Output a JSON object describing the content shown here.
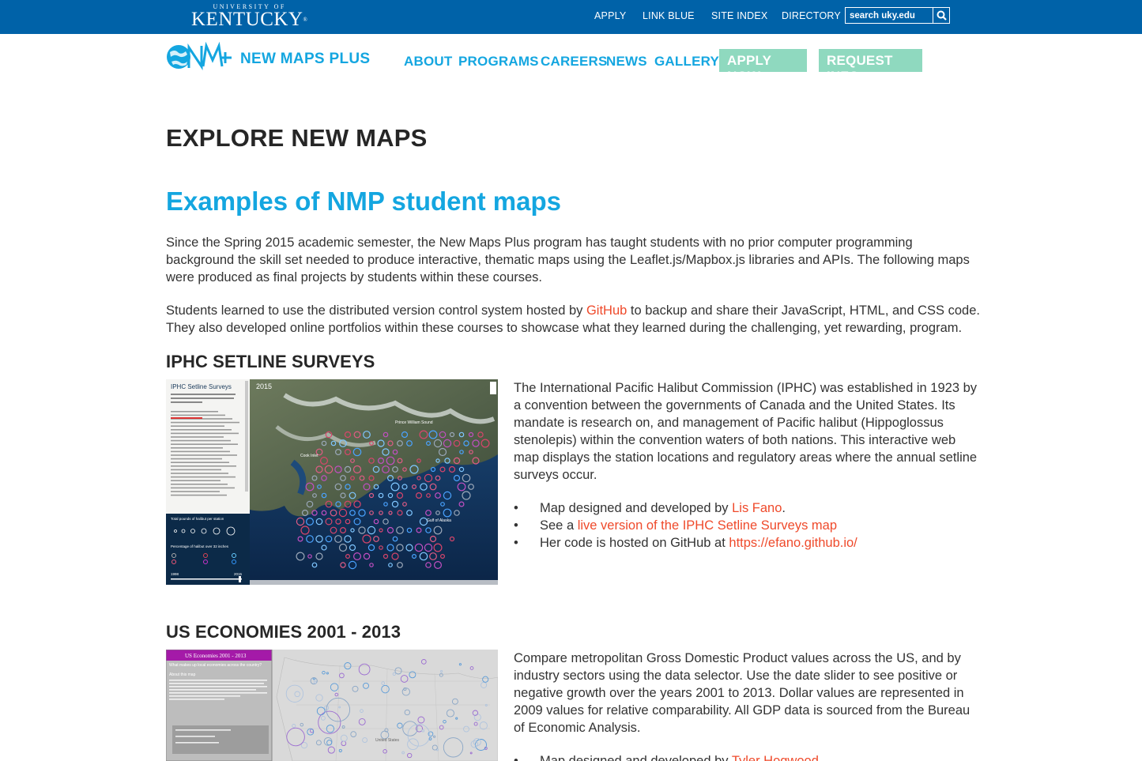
{
  "uk_bar": {
    "logo_top": "UNIVERSITY OF",
    "logo_main": "KENTUCKY",
    "links": [
      "APPLY",
      "LINK BLUE",
      "SITE INDEX",
      "DIRECTORY"
    ],
    "search_value": "search uky.edu"
  },
  "site": {
    "title": "NEW MAPS PLUS"
  },
  "nav": {
    "items": [
      "ABOUT",
      "PROGRAMS",
      "CAREERS",
      "NEWS",
      "GALLERY"
    ],
    "apply_now": "APPLY NOW",
    "request_info": "REQUEST INFO"
  },
  "page": {
    "heading": "EXPLORE NEW MAPS",
    "subheading": "Examples of NMP student maps",
    "intro": "Since the Spring 2015 academic semester, the New Maps Plus program has taught students with no prior computer programming background the skill set needed to produce interactive, thematic maps using the Leaflet.js/Mapbox.js libraries and APIs. The following maps were produced as final projects by students within these courses.",
    "para2_before": "Students learned to use the distributed version control system hosted by ",
    "para2_link": "GitHub",
    "para2_after": " to backup and share their JavaScript, HTML, and CSS code. They also developed online portfolios within these courses to showcase what they learned during the challenging, yet rewarding, program."
  },
  "sections": [
    {
      "title": "IPHC SETLINE SURVEYS",
      "description": "The International Pacific Halibut Commission (IPHC) was established in 1923 by a convention between the governments of Canada and the United States. Its mandate is research on, and management of Pacific halibut (Hippoglossus stenolepis) within the convention waters of both nations. This interactive web map displays the station locations and regulatory areas where the annual setline surveys occur.",
      "bullet1_before": "Map designed and developed by ",
      "bullet1_link": "Lis Fano",
      "bullet1_after": ".",
      "bullet2_before": "See a ",
      "bullet2_link": "live version of the IPHC Setline Surveys map",
      "bullet3_before": "Her code is hosted on GitHub at ",
      "bullet3_link": "https://efano.github.io/",
      "thumb": {
        "title": "IPHC Setline Surveys",
        "subtitle": "Mapping change in weight, length, and abundance of Pacific Halibut: 1998 - 2015",
        "year": "2015",
        "legend_title": "Total pounds of halibut per station",
        "legend_pct": "Percentage of halibut over 32 inches",
        "slider_start": "1998",
        "slider_end": "2015",
        "place1": "Cook Inlet",
        "place2": "Prince William Sound",
        "place3": "Gulf of Alaska"
      }
    },
    {
      "title": "US ECONOMIES 2001 - 2013",
      "description": "Compare metropolitan Gross Domestic Product values across the US, and by industry sectors using the data selector. Use the date slider to see positive or negative growth over the years 2001 to 2013. Dollar values are represented in 2009 values for relative comparability. All GDP data is sourced from the Bureau of Economic Analysis.",
      "bullet1_before": "Map designed and developed by ",
      "bullet1_link": "Tyler Hogwood",
      "thumb": {
        "title": "US Economies 2001 - 2013",
        "subtitle": "What makes up local economies across the country?",
        "about": "About this map",
        "states": "United States"
      }
    }
  ],
  "colors": {
    "uk_blue": "#0062a8",
    "nmp_blue": "#14a6e0",
    "nav_button": "#8fd9bf",
    "link": "#ef4a2b",
    "us_econ_purple": "#a41aa8"
  }
}
